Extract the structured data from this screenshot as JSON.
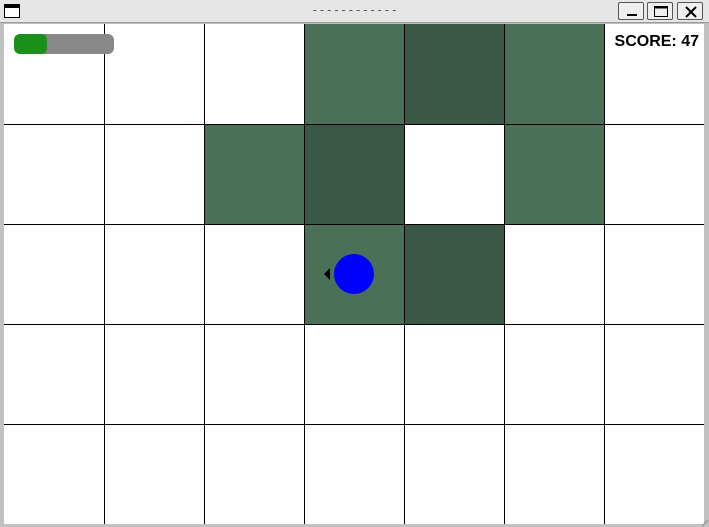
{
  "window": {
    "title": "------------",
    "buttons": {
      "minimize_icon": "minimize-icon",
      "maximize_icon": "maximize-icon",
      "close_icon": "close-icon"
    }
  },
  "hud": {
    "score_text": "SCORE: 47",
    "health_fraction": 0.33,
    "health_color": "#1a8f1a",
    "health_bg": "#888888"
  },
  "board": {
    "cols": 7,
    "rows": 5,
    "colors": {
      "light": "#4a7058",
      "dark": "#3a5846",
      "empty": "#ffffff"
    },
    "shaded_cells": [
      {
        "col": 3,
        "row": 0,
        "shade": "light"
      },
      {
        "col": 4,
        "row": 0,
        "shade": "dark"
      },
      {
        "col": 5,
        "row": 0,
        "shade": "light"
      },
      {
        "col": 2,
        "row": 1,
        "shade": "light"
      },
      {
        "col": 3,
        "row": 1,
        "shade": "dark"
      },
      {
        "col": 5,
        "row": 1,
        "shade": "light"
      },
      {
        "col": 3,
        "row": 2,
        "shade": "light"
      },
      {
        "col": 4,
        "row": 2,
        "shade": "dark"
      }
    ]
  },
  "player": {
    "col": 3,
    "row": 2,
    "color": "#0000ff",
    "facing": "left"
  }
}
